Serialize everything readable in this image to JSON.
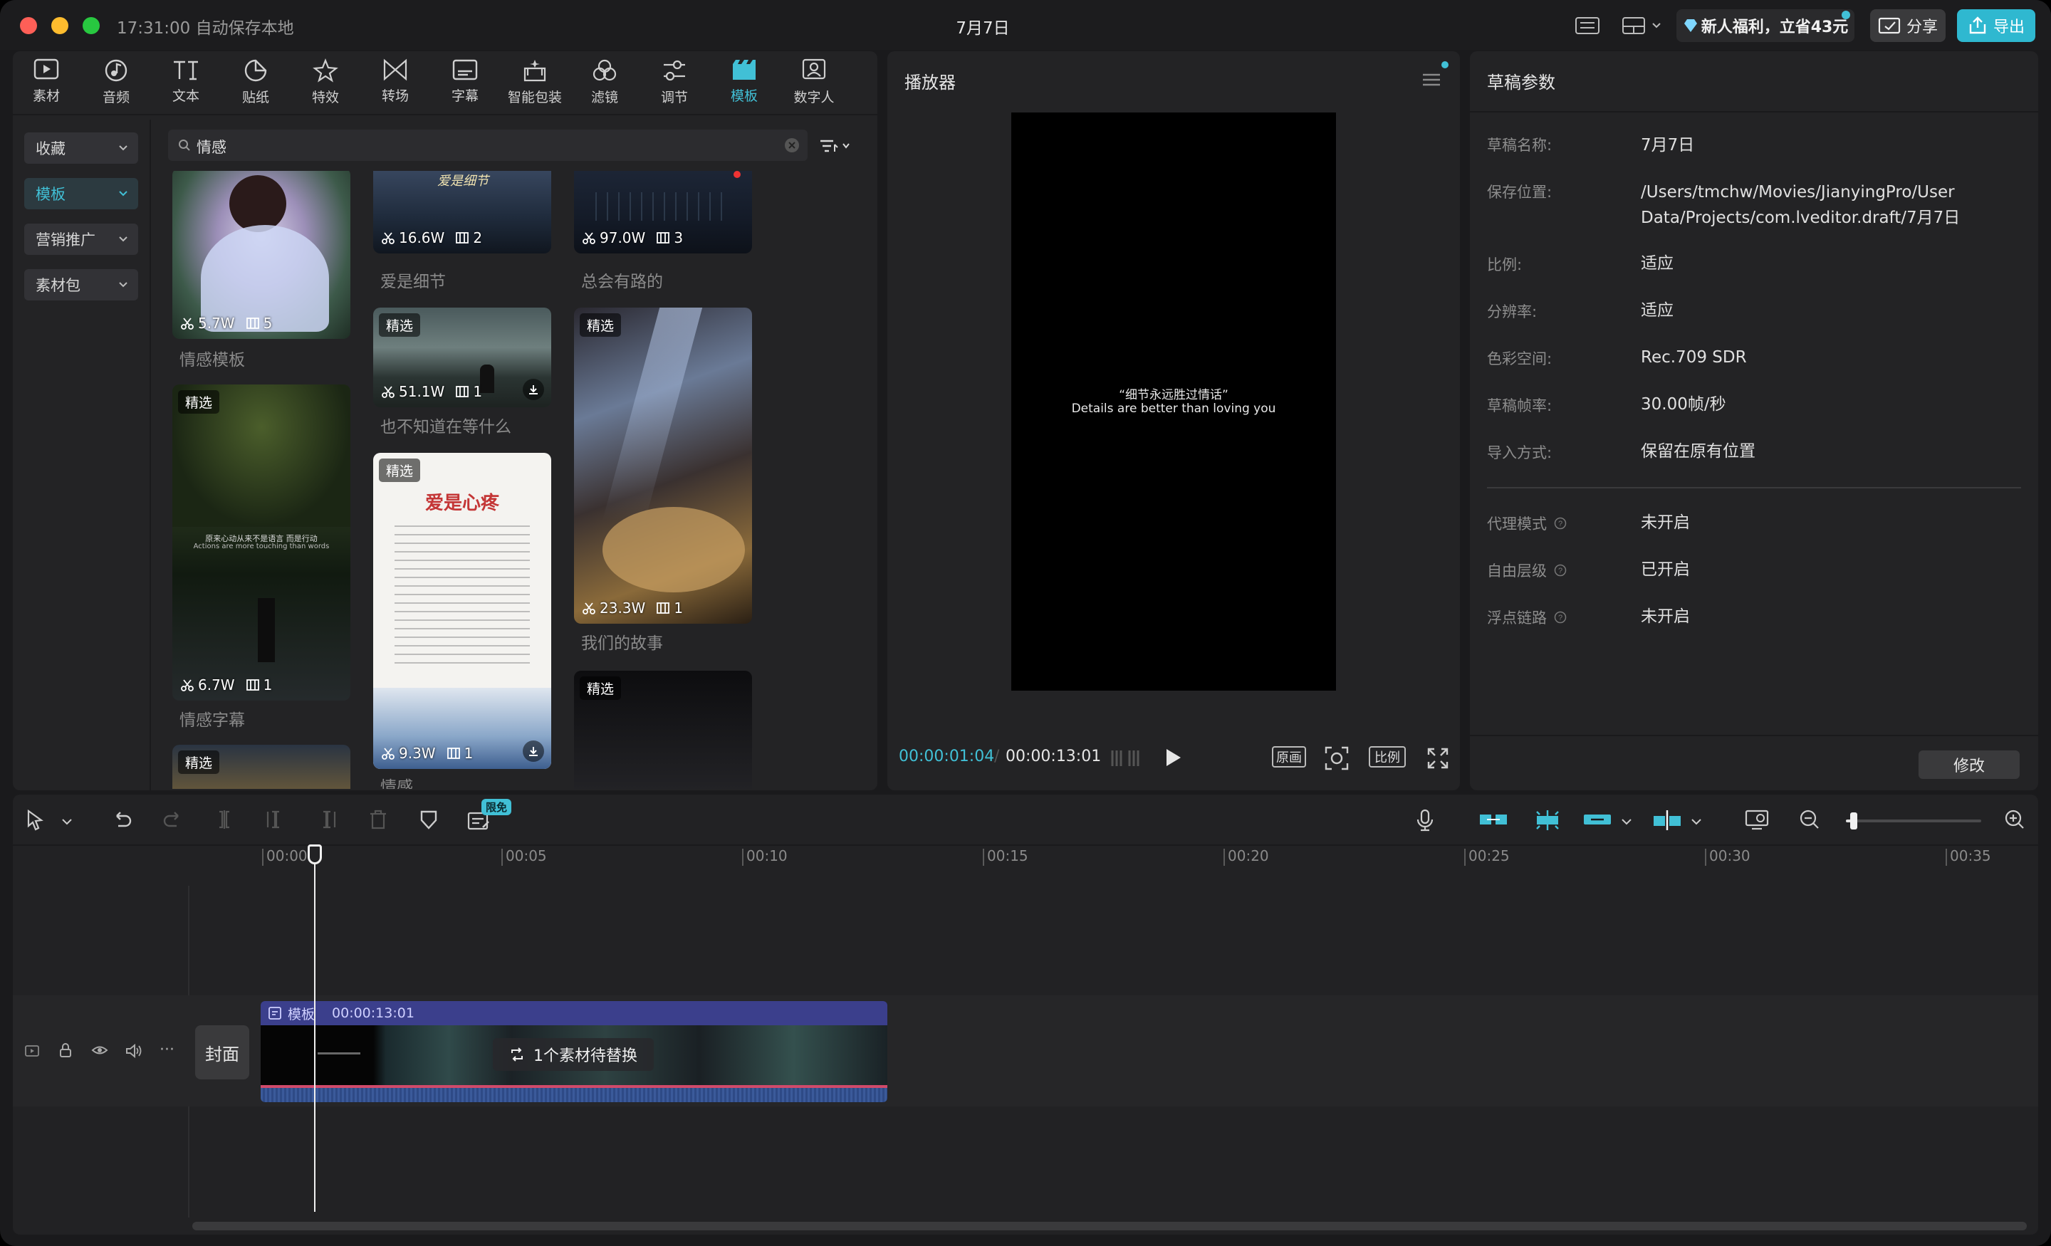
{
  "window": {
    "clock": "17:31:00",
    "autosave": "自动保存本地",
    "title": "7月7日"
  },
  "titlebar": {
    "promo": "新人福利，立省43元",
    "share_label": "分享",
    "export_label": "导出"
  },
  "toolbar": {
    "tools": [
      {
        "label": "素材",
        "icon": "media-icon"
      },
      {
        "label": "音频",
        "icon": "audio-icon"
      },
      {
        "label": "文本",
        "icon": "text-icon"
      },
      {
        "label": "贴纸",
        "icon": "sticker-icon"
      },
      {
        "label": "特效",
        "icon": "effects-icon"
      },
      {
        "label": "转场",
        "icon": "transition-icon"
      },
      {
        "label": "字幕",
        "icon": "subtitle-icon"
      },
      {
        "label": "智能包装",
        "icon": "smart-pack-icon"
      },
      {
        "label": "滤镜",
        "icon": "filter-icon"
      },
      {
        "label": "调节",
        "icon": "adjust-icon"
      },
      {
        "label": "模板",
        "icon": "template-icon"
      },
      {
        "label": "数字人",
        "icon": "digital-human-icon"
      }
    ],
    "active": "模板"
  },
  "sidebar": {
    "items": [
      {
        "label": "收藏"
      },
      {
        "label": "模板"
      },
      {
        "label": "营销推广"
      },
      {
        "label": "素材包"
      }
    ],
    "active": "模板"
  },
  "search": {
    "value": "情感"
  },
  "templates": [
    {
      "title": "情感模板",
      "uses": "5.7W",
      "clips": "5",
      "tag": ""
    },
    {
      "title": "情感字幕",
      "uses": "6.7W",
      "clips": "1",
      "tag": "精选",
      "caption_cn": "原来心动从来不是语言 而是行动",
      "caption_en": "Actions are more touching than words"
    },
    {
      "title": "",
      "uses": "",
      "clips": "",
      "tag": "精选"
    },
    {
      "title": "爱是细节",
      "uses": "16.6W",
      "clips": "2",
      "tag": "",
      "art_text": "爱是细节"
    },
    {
      "title": "也不知道在等什么",
      "uses": "51.1W",
      "clips": "1",
      "tag": "精选"
    },
    {
      "title": "情感",
      "uses": "9.3W",
      "clips": "1",
      "tag": "精选",
      "heading": "爱是心疼"
    },
    {
      "title": "总会有路的",
      "uses": "97.0W",
      "clips": "3",
      "tag": ""
    },
    {
      "title": "我们的故事",
      "uses": "23.3W",
      "clips": "1",
      "tag": "精选"
    },
    {
      "title": "",
      "uses": "",
      "clips": "",
      "tag": "精选"
    }
  ],
  "player": {
    "title": "播放器",
    "subtitle_cn": "“细节永远胜过情话”",
    "subtitle_en": "Details are better than loving you",
    "current_time": "00:00:01:04",
    "total_time": "00:00:13:01",
    "btn_original": "原画",
    "btn_ratio": "比例"
  },
  "draft": {
    "title": "草稿参数",
    "params": [
      {
        "label": "草稿名称:",
        "value": "7月7日"
      },
      {
        "label": "保存位置:",
        "value": "/Users/tmchw/Movies/JianyingPro/User Data/Projects/com.lveditor.draft/7月7日"
      },
      {
        "label": "比例:",
        "value": "适应"
      },
      {
        "label": "分辨率:",
        "value": "适应"
      },
      {
        "label": "色彩空间:",
        "value": "Rec.709 SDR"
      },
      {
        "label": "草稿帧率:",
        "value": "30.00帧/秒"
      },
      {
        "label": "导入方式:",
        "value": "保留在原有位置"
      }
    ],
    "advanced": [
      {
        "label": "代理模式",
        "value": "未开启"
      },
      {
        "label": "自由层级",
        "value": "已开启"
      },
      {
        "label": "浮点链路",
        "value": "未开启"
      }
    ],
    "modify_label": "修改"
  },
  "timeline": {
    "badge": "限免",
    "ticks": [
      "00:00",
      "00:05",
      "00:10",
      "00:15",
      "00:20",
      "00:25",
      "00:30",
      "00:35"
    ],
    "cover_label": "封面",
    "clip": {
      "label": "模板",
      "duration": "00:00:13:01",
      "replace_text": "1个素材待替换"
    },
    "zoom_level": 0.04
  },
  "colors": {
    "accent": "#41c0d6",
    "clip_header": "#3b3f8c",
    "window_bg": "#1a1a1c",
    "panel_bg": "#232325"
  }
}
